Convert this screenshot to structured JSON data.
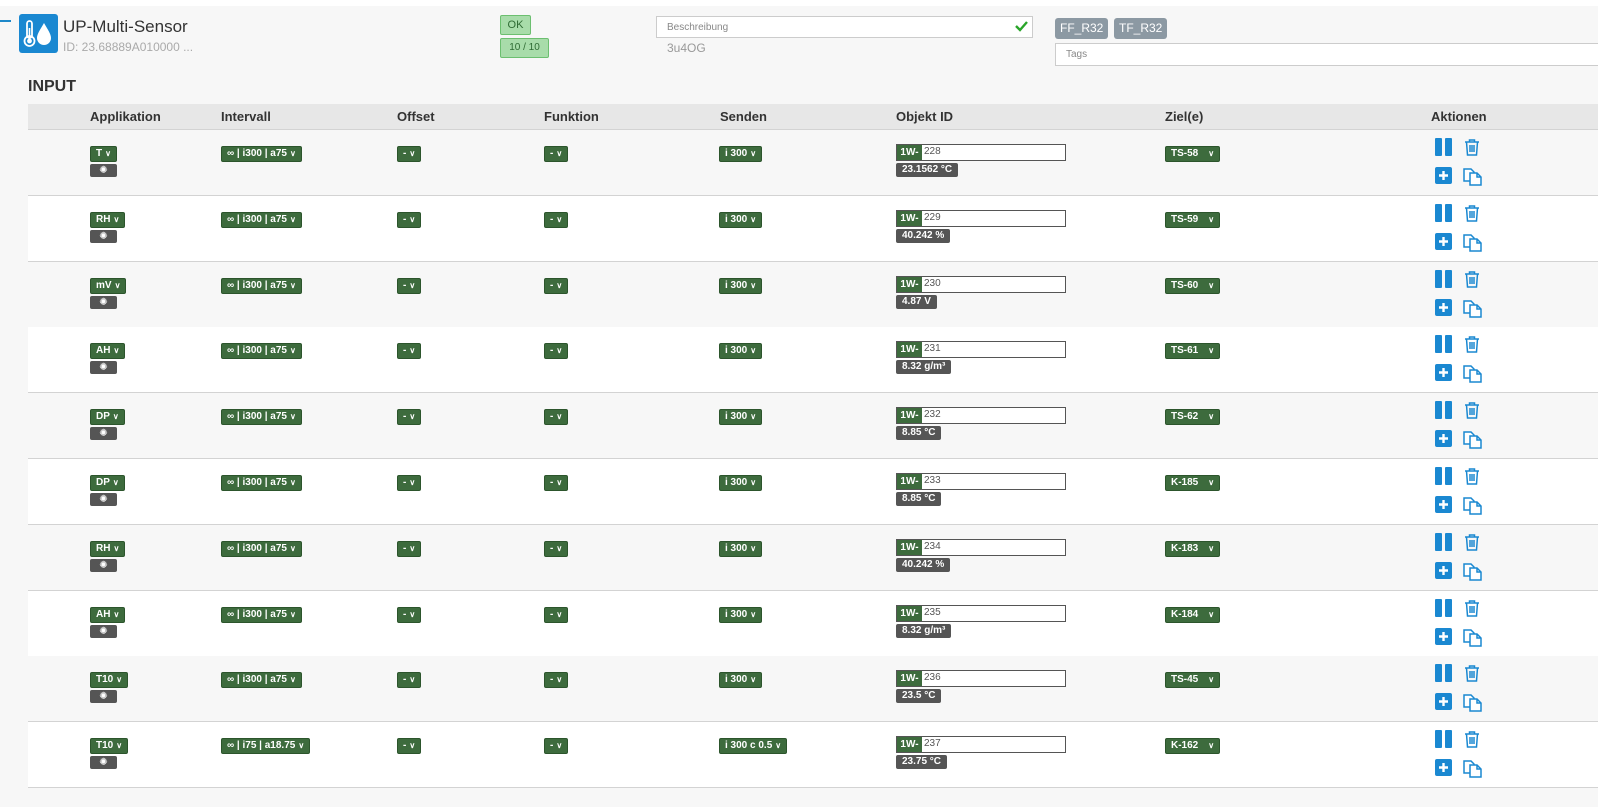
{
  "device": {
    "title": "UP-Multi-Sensor",
    "id": "ID: 23.68889A010000 ...",
    "status": "OK",
    "count": "10 / 10",
    "description_placeholder": "Beschreibung",
    "description_value": "3u4OG",
    "tags": [
      "FF_R32",
      "TF_R32"
    ],
    "tags_placeholder": "Tags"
  },
  "section_title": "INPUT",
  "columns": {
    "applikation": "Applikation",
    "intervall": "Intervall",
    "offset": "Offset",
    "funktion": "Funktion",
    "senden": "Senden",
    "objekt_id": "Objekt ID",
    "ziel": "Ziel(e)",
    "aktionen": "Aktionen"
  },
  "rows": [
    {
      "app": "T",
      "interval": "∞ | i300 | a75",
      "offset": "-",
      "function": "-",
      "send": "i 300",
      "obj_prefix": "1W-",
      "obj_id": "228",
      "value": "23.1562 °C",
      "target": "TS-58"
    },
    {
      "app": "RH",
      "interval": "∞ | i300 | a75",
      "offset": "-",
      "function": "-",
      "send": "i 300",
      "obj_prefix": "1W-",
      "obj_id": "229",
      "value": "40.242 %",
      "target": "TS-59"
    },
    {
      "app": "mV",
      "interval": "∞ | i300 | a75",
      "offset": "-",
      "function": "-",
      "send": "i 300",
      "obj_prefix": "1W-",
      "obj_id": "230",
      "value": "4.87 V",
      "target": "TS-60"
    },
    {
      "app": "AH",
      "interval": "∞ | i300 | a75",
      "offset": "-",
      "function": "-",
      "send": "i 300",
      "obj_prefix": "1W-",
      "obj_id": "231",
      "value": "8.32 g/m³",
      "target": "TS-61"
    },
    {
      "app": "DP",
      "interval": "∞ | i300 | a75",
      "offset": "-",
      "function": "-",
      "send": "i 300",
      "obj_prefix": "1W-",
      "obj_id": "232",
      "value": "8.85 °C",
      "target": "TS-62"
    },
    {
      "app": "DP",
      "interval": "∞ | i300 | a75",
      "offset": "-",
      "function": "-",
      "send": "i 300",
      "obj_prefix": "1W-",
      "obj_id": "233",
      "value": "8.85 °C",
      "target": "K-185"
    },
    {
      "app": "RH",
      "interval": "∞ | i300 | a75",
      "offset": "-",
      "function": "-",
      "send": "i 300",
      "obj_prefix": "1W-",
      "obj_id": "234",
      "value": "40.242 %",
      "target": "K-183"
    },
    {
      "app": "AH",
      "interval": "∞ | i300 | a75",
      "offset": "-",
      "function": "-",
      "send": "i 300",
      "obj_prefix": "1W-",
      "obj_id": "235",
      "value": "8.32 g/m³",
      "target": "K-184"
    },
    {
      "app": "T10",
      "interval": "∞ | i300 | a75",
      "offset": "-",
      "function": "-",
      "send": "i 300",
      "obj_prefix": "1W-",
      "obj_id": "236",
      "value": "23.5 °C",
      "target": "TS-45"
    },
    {
      "app": "T10",
      "interval": "∞ | i75 | a18.75",
      "offset": "-",
      "function": "-",
      "send": "i 300 c 0.5",
      "obj_prefix": "1W-",
      "obj_id": "237",
      "value": "23.75 °C",
      "target": "K-162"
    }
  ],
  "colors": {
    "accent_blue": "#1a88d1",
    "dropdown_green": "#3d6b3d",
    "value_gray": "#555555",
    "ok_green": "#a8dcaa",
    "tag_gray": "#8c99a3"
  },
  "icons": {
    "device": "thermometer-droplet-icon",
    "description_ok": "check-icon",
    "settings": "cog-icon",
    "pause": "pause-icon",
    "delete": "trash-icon",
    "add": "plus-square-icon",
    "copy": "copy-icon"
  }
}
